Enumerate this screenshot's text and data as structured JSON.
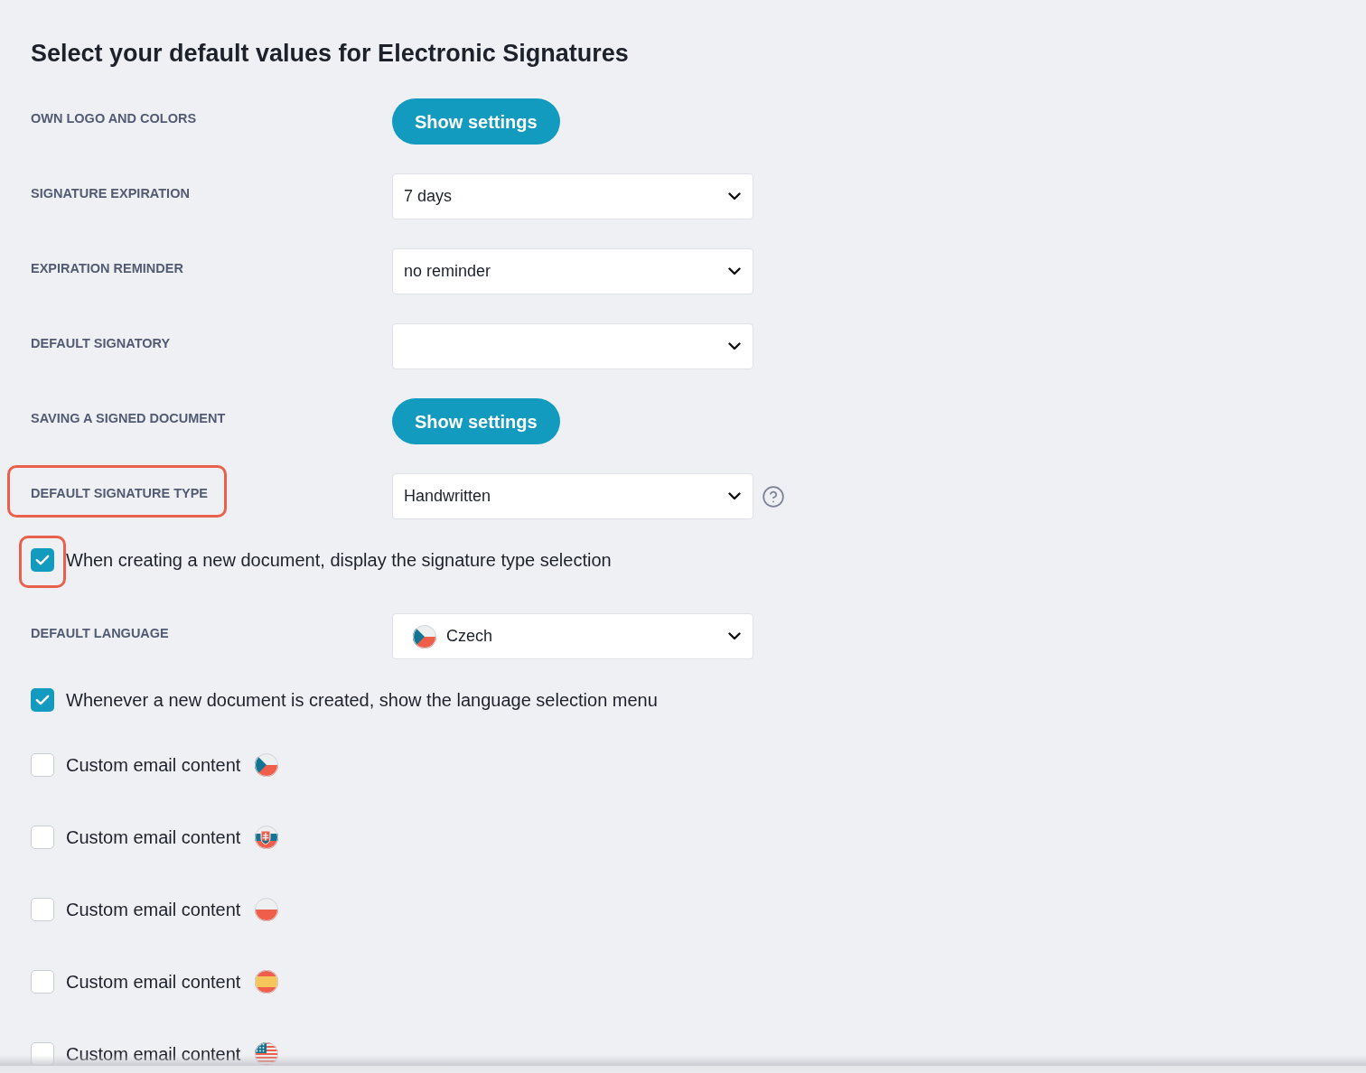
{
  "title": "Select your default values for Electronic Signatures",
  "settings": [
    {
      "kind": "button",
      "label": "OWN LOGO AND COLORS",
      "button": "Show settings",
      "highlighted": false
    },
    {
      "kind": "select",
      "label": "SIGNATURE EXPIRATION",
      "value": "7 days",
      "help": false,
      "highlighted": false
    },
    {
      "kind": "select",
      "label": "EXPIRATION REMINDER",
      "value": "no reminder",
      "help": false,
      "highlighted": false
    },
    {
      "kind": "select",
      "label": "DEFAULT SIGNATORY",
      "help": false,
      "highlighted": false
    },
    {
      "kind": "button",
      "label": "SAVING A SIGNED DOCUMENT",
      "button": "Show settings",
      "highlighted": false
    },
    {
      "kind": "select",
      "label": "DEFAULT SIGNATURE TYPE",
      "value": "Handwritten",
      "help": true,
      "highlighted": true
    },
    {
      "kind": "checkbox",
      "text": "When creating a new document, display the signature type selection",
      "checked": true,
      "highlighted": true
    },
    {
      "kind": "select",
      "label": "DEFAULT LANGUAGE",
      "value": "Czech",
      "flag": {
        "kind": "czech"
      },
      "help": false,
      "highlighted": false
    },
    {
      "kind": "checkbox",
      "text": "Whenever a new document is created, show the language selection menu",
      "checked": true,
      "highlighted": false
    },
    {
      "kind": "checkbox",
      "text": "Custom email content",
      "checked": false,
      "flag": {
        "kind": "czech"
      },
      "highlighted": false
    },
    {
      "kind": "checkbox",
      "text": "Custom email content",
      "checked": false,
      "flag": {
        "kind": "slovak"
      },
      "highlighted": false
    },
    {
      "kind": "checkbox",
      "text": "Custom email content",
      "checked": false,
      "flag": {
        "kind": "polish"
      },
      "highlighted": false
    },
    {
      "kind": "checkbox",
      "text": "Custom email content",
      "checked": false,
      "flag": {
        "kind": "spanish"
      },
      "highlighted": false
    },
    {
      "kind": "checkbox",
      "text": "Custom email content",
      "checked": false,
      "flag": {
        "kind": "american"
      },
      "highlighted": false
    }
  ]
}
